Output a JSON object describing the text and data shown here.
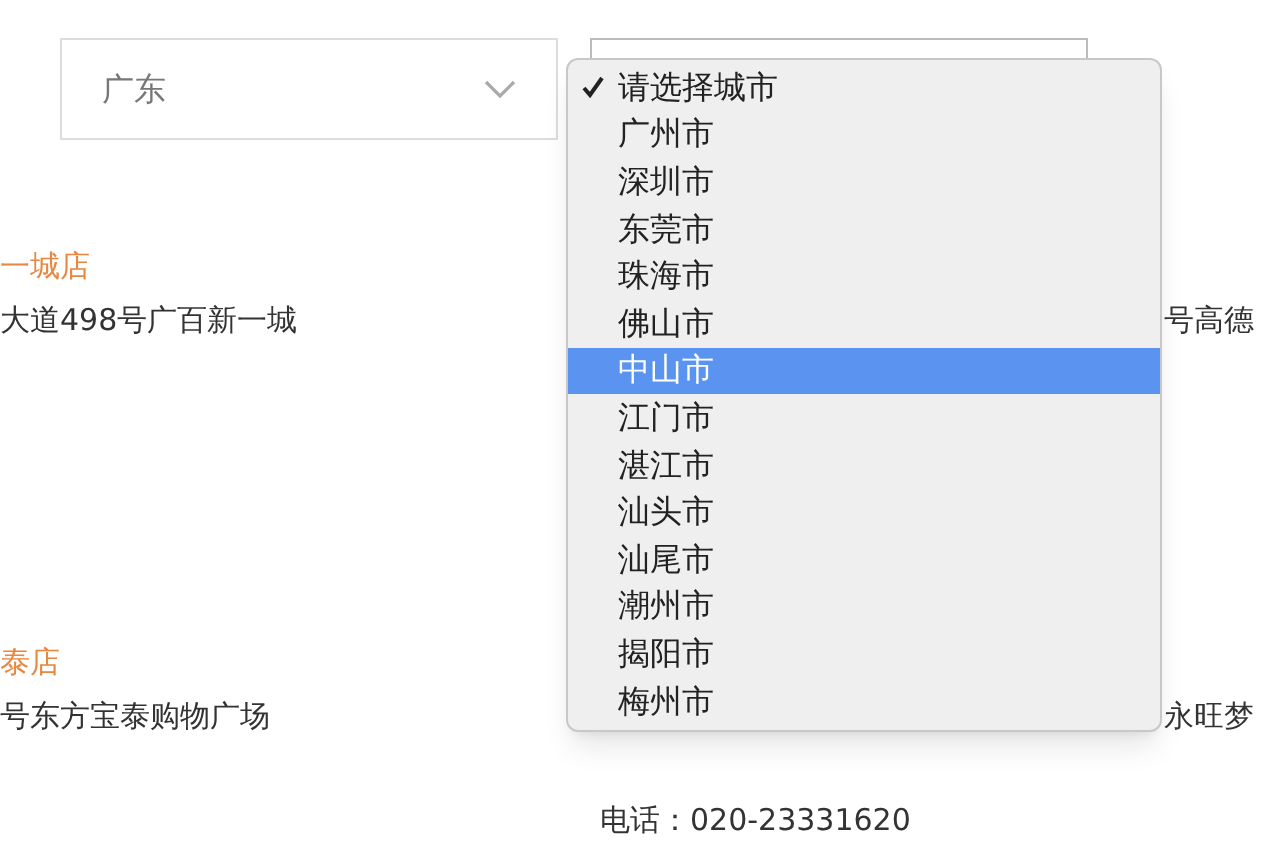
{
  "province_select": {
    "value": "广东"
  },
  "city_menu": {
    "options": [
      {
        "label": "请选择城市",
        "checked": true,
        "highlighted": false
      },
      {
        "label": "广州市",
        "checked": false,
        "highlighted": false
      },
      {
        "label": "深圳市",
        "checked": false,
        "highlighted": false
      },
      {
        "label": "东莞市",
        "checked": false,
        "highlighted": false
      },
      {
        "label": "珠海市",
        "checked": false,
        "highlighted": false
      },
      {
        "label": "佛山市",
        "checked": false,
        "highlighted": false
      },
      {
        "label": "中山市",
        "checked": false,
        "highlighted": true
      },
      {
        "label": "江门市",
        "checked": false,
        "highlighted": false
      },
      {
        "label": "湛江市",
        "checked": false,
        "highlighted": false
      },
      {
        "label": "汕头市",
        "checked": false,
        "highlighted": false
      },
      {
        "label": "汕尾市",
        "checked": false,
        "highlighted": false
      },
      {
        "label": "潮州市",
        "checked": false,
        "highlighted": false
      },
      {
        "label": "揭阳市",
        "checked": false,
        "highlighted": false
      },
      {
        "label": "梅州市",
        "checked": false,
        "highlighted": false
      }
    ]
  },
  "store_rows": [
    {
      "left": {
        "name": "一城店",
        "address": "大道498号广百新一城"
      },
      "right": {
        "address": "号高德"
      }
    },
    {
      "left": {
        "name": "泰店",
        "address": "号东方宝泰购物广场"
      },
      "middle": {
        "phone": "电话：020-23331620"
      },
      "right": {
        "address": "永旺梦"
      }
    }
  ]
}
